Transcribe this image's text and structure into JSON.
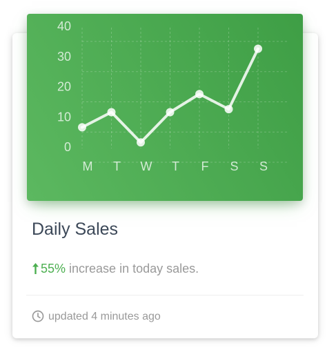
{
  "card": {
    "title": "Daily Sales",
    "increase_percent": "55%",
    "increase_text": " increase in today sales.",
    "updated_text": "updated 4 minutes ago",
    "icons": {
      "increase": "arrow-upward-icon",
      "updated": "access-time-icon"
    }
  },
  "colors": {
    "header_gradient_start": "#5cb860",
    "header_gradient_end": "#3e9e45",
    "accent_green": "#4caf50",
    "title": "#3c4858",
    "muted": "#999999"
  },
  "chart_data": {
    "type": "line",
    "categories": [
      "M",
      "T",
      "W",
      "T",
      "F",
      "S",
      "S"
    ],
    "values": [
      7,
      12,
      2,
      12,
      18,
      13,
      33
    ],
    "yticks": [
      0,
      10,
      20,
      30,
      40
    ],
    "ylim": [
      0,
      40
    ],
    "grid": true
  }
}
